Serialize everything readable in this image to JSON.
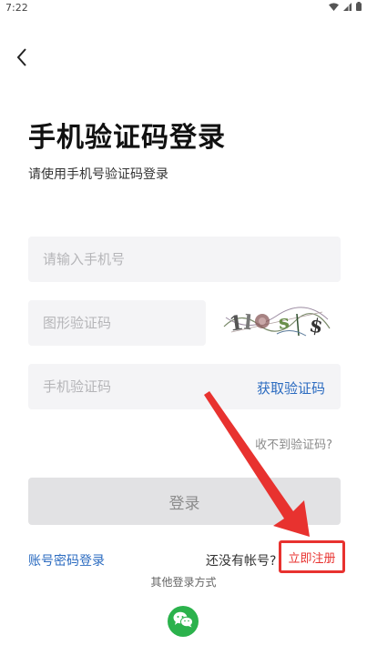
{
  "status_bar": {
    "time": "7:22",
    "icons": [
      "wifi-icon",
      "signal-icon",
      "battery-icon"
    ]
  },
  "nav": {
    "back_icon": "chevron-left-icon"
  },
  "header": {
    "title": "手机验证码登录",
    "subtitle": "请使用手机号验证码登录"
  },
  "form": {
    "phone_placeholder": "请输入手机号",
    "image_code_placeholder": "图形验证码",
    "sms_code_placeholder": "手机验证码",
    "get_code_label": "获取验证码",
    "no_code_label": "收不到验证码?",
    "login_label": "登录",
    "captcha_text": "1l8s$"
  },
  "footer": {
    "password_login": "账号密码登录",
    "no_account": "还没有帐号?",
    "register": "立即注册",
    "other_methods": "其他登录方式",
    "wechat_icon": "wechat-icon"
  },
  "colors": {
    "link_blue": "#2b6bc0",
    "highlight_red": "#e8322f",
    "wechat_green": "#2bb24c",
    "field_bg": "#f4f4f6",
    "button_bg": "#e2e2e4"
  }
}
